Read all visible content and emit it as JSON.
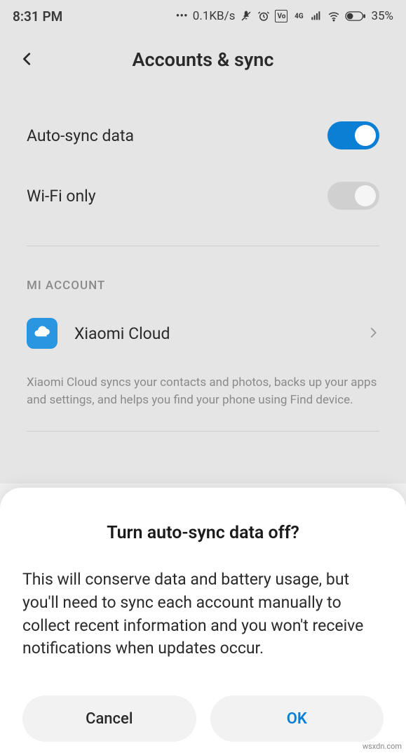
{
  "status": {
    "time": "8:31 PM",
    "speed": "0.1KB/s",
    "battery": "35%"
  },
  "header": {
    "title": "Accounts & sync"
  },
  "settings": {
    "auto_sync": {
      "label": "Auto-sync data",
      "enabled": true
    },
    "wifi_only": {
      "label": "Wi-Fi only",
      "enabled": false
    }
  },
  "section": {
    "mi_account": "MI ACCOUNT"
  },
  "account": {
    "xiaomi_cloud": "Xiaomi Cloud",
    "description": "Xiaomi Cloud syncs your contacts and photos, backs up your apps and settings, and helps you find your phone using Find device."
  },
  "dialog": {
    "title": "Turn auto-sync data off?",
    "body": "This will conserve data and battery usage, but you'll need to sync each account manually to collect recent information and you won't receive notifications when updates occur.",
    "cancel": "Cancel",
    "ok": "OK"
  },
  "watermark": "wsxdn.com"
}
